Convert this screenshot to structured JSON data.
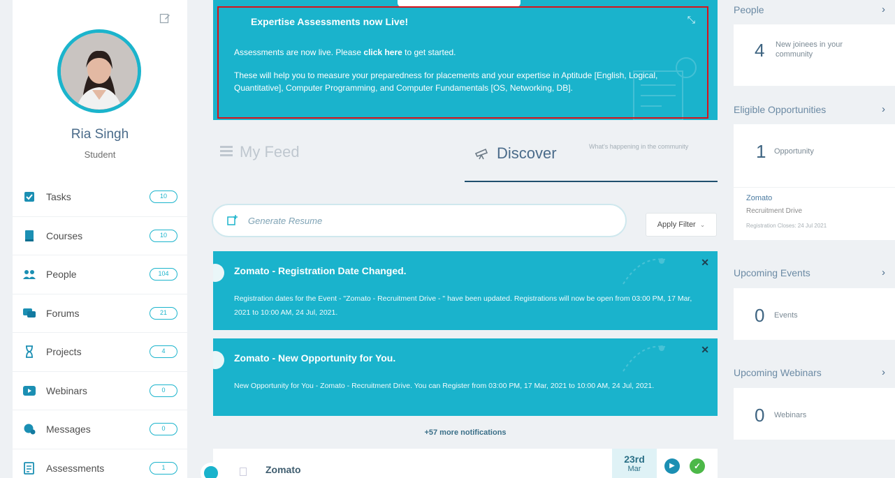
{
  "profile": {
    "name": "Ria Singh",
    "role": "Student",
    "edit_icon": "edit-icon"
  },
  "sidebar": {
    "items": [
      {
        "label": "Tasks",
        "count": "10",
        "icon": "tasks-icon",
        "color": "#1b8fb3"
      },
      {
        "label": "Courses",
        "count": "10",
        "icon": "book-icon",
        "color": "#1b8fb3"
      },
      {
        "label": "People",
        "count": "104",
        "icon": "people-icon",
        "color": "#1b8fb3"
      },
      {
        "label": "Forums",
        "count": "21",
        "icon": "forums-icon",
        "color": "#1b8fb3"
      },
      {
        "label": "Projects",
        "count": "4",
        "icon": "hourglass-icon",
        "color": "#1b8fb3"
      },
      {
        "label": "Webinars",
        "count": "0",
        "icon": "video-icon",
        "color": "#1b8fb3"
      },
      {
        "label": "Messages",
        "count": "0",
        "icon": "chat-icon",
        "color": "#1b8fb3"
      },
      {
        "label": "Assessments",
        "count": "1",
        "icon": "assessment-icon",
        "color": "#1b8fb3"
      }
    ]
  },
  "banner": {
    "title": "Expertise Assessments now Live!",
    "line1_before": "Assessments are now live. Please ",
    "line1_link": "click here",
    "line1_after": " to get started.",
    "line2": "These will help you to measure your preparedness for placements and your expertise in Aptitude [English, Logical, Quantitative], Computer Programming, and Computer Fundamentals [OS, Networking, DB].",
    "background": "#1ab3cc",
    "highlight_border": "#d8121a"
  },
  "tabs": {
    "feed_label": "My Feed",
    "discover_label": "Discover",
    "discover_sub": "What's happening in the community"
  },
  "toolbar": {
    "resume_placeholder": "Generate Resume",
    "filter_label": "Apply Filter"
  },
  "notifications": [
    {
      "title": "Zomato - Registration Date Changed.",
      "body": "Registration dates for the Event - \"Zomato - Recruitment Drive - \" have been updated. Registrations will now be open from 03:00 PM, 17 Mar, 2021 to 10:00 AM, 24 Jul, 2021."
    },
    {
      "title": "Zomato - New Opportunity for You.",
      "body": "New Opportunity for You - Zomato - Recruitment Drive. You can Register from 03:00 PM, 17 Mar, 2021 to 10:00 AM, 24 Jul, 2021."
    }
  ],
  "more_notifications": "+57 more notifications",
  "feed_card": {
    "title": "Zomato",
    "day": "23rd",
    "month": "Mar"
  },
  "right": {
    "people": {
      "heading": "People",
      "count": "4",
      "text": "New joinees in your community"
    },
    "opportunities": {
      "heading": "Eligible Opportunities",
      "count": "1",
      "text": "Opportunity",
      "item_name": "Zomato",
      "item_sub": "Recruitment Drive",
      "item_date": "Registration Closes: 24 Jul 2021"
    },
    "events": {
      "heading": "Upcoming Events",
      "count": "0",
      "text": "Events"
    },
    "webinars": {
      "heading": "Upcoming Webinars",
      "count": "0",
      "text": "Webinars"
    }
  }
}
